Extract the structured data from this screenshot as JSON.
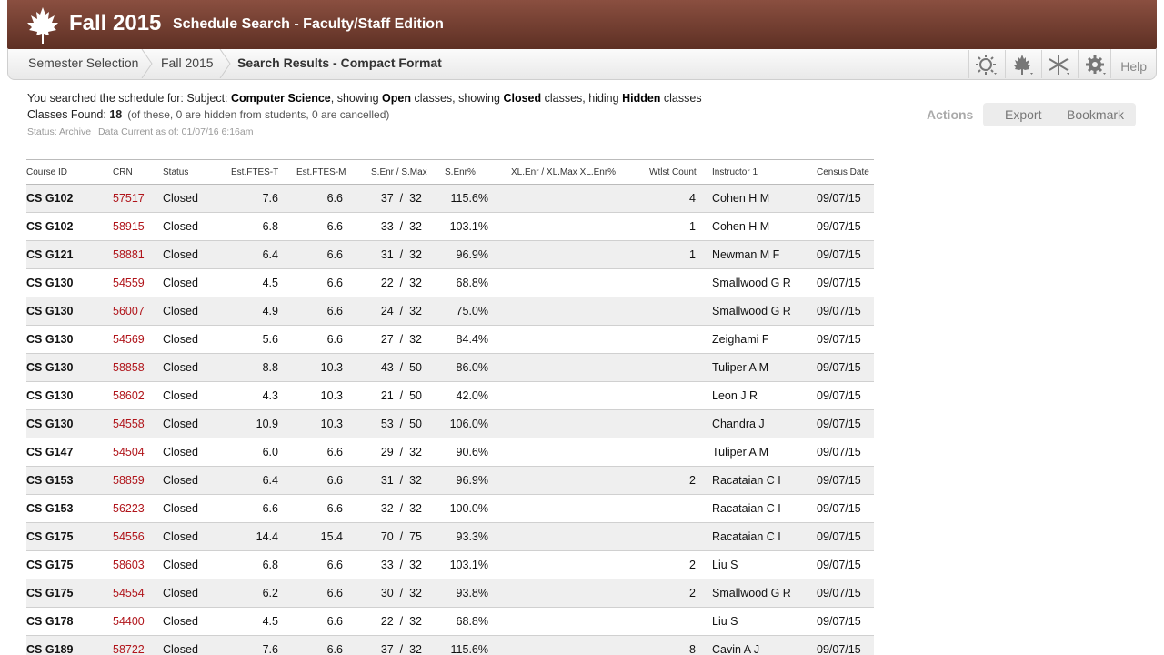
{
  "header": {
    "term": "Fall 2015",
    "title": "Schedule Search - Faculty/Staff Edition",
    "logo_icon": "maple-leaf-icon"
  },
  "breadcrumb": {
    "items": [
      "Semester Selection",
      "Fall 2015",
      "Search Results - Compact Format"
    ]
  },
  "toolbar": {
    "icons": [
      "sun-icon",
      "maple-leaf-icon",
      "asterisk-icon",
      "gear-icon"
    ],
    "help_label": "Help"
  },
  "search": {
    "prefix": "You searched the schedule for: Subject: ",
    "subject": "Computer Science",
    "mid1": ", showing ",
    "open": "Open",
    "mid2": " classes, showing ",
    "closed": "Closed",
    "mid3": " classes, hiding ",
    "hidden": "Hidden",
    "suffix": " classes",
    "found_label": "Classes Found: ",
    "found_count": "18",
    "found_note": "(of these, 0 are hidden from students, 0 are cancelled)",
    "status_label": "Status: Archive",
    "current_label": "Data Current as of: 01/07/16  6:16am"
  },
  "actions": {
    "label": "Actions",
    "export": "Export",
    "bookmark": "Bookmark"
  },
  "table": {
    "headers": {
      "course": "Course ID",
      "crn": "CRN",
      "status": "Status",
      "ftes_t": "Est.FTES-T",
      "ftes_m": "Est.FTES-M",
      "senr_max": "S.Enr  /  S.Max",
      "senr_pct": "S.Enr%",
      "xl": "XL.Enr  /  XL.Max XL.Enr%",
      "wtlst": "Wtlst Count",
      "instructor": "Instructor 1",
      "census": "Census Date"
    },
    "rows": [
      {
        "course": "CS G102",
        "crn": "57517",
        "status": "Closed",
        "ftes_t": "7.6",
        "ftes_m": "6.6",
        "senr": "37  /  32",
        "pct": "115.6%",
        "wtlst": "4",
        "instructor": "Cohen H M",
        "census": "09/07/15"
      },
      {
        "course": "CS G102",
        "crn": "58915",
        "status": "Closed",
        "ftes_t": "6.8",
        "ftes_m": "6.6",
        "senr": "33  /  32",
        "pct": "103.1%",
        "wtlst": "1",
        "instructor": "Cohen H M",
        "census": "09/07/15"
      },
      {
        "course": "CS G121",
        "crn": "58881",
        "status": "Closed",
        "ftes_t": "6.4",
        "ftes_m": "6.6",
        "senr": "31  /  32",
        "pct": "96.9%",
        "wtlst": "1",
        "instructor": "Newman M F",
        "census": "09/07/15"
      },
      {
        "course": "CS G130",
        "crn": "54559",
        "status": "Closed",
        "ftes_t": "4.5",
        "ftes_m": "6.6",
        "senr": "22  /  32",
        "pct": "68.8%",
        "wtlst": "",
        "instructor": "Smallwood G R",
        "census": "09/07/15"
      },
      {
        "course": "CS G130",
        "crn": "56007",
        "status": "Closed",
        "ftes_t": "4.9",
        "ftes_m": "6.6",
        "senr": "24  /  32",
        "pct": "75.0%",
        "wtlst": "",
        "instructor": "Smallwood G R",
        "census": "09/07/15"
      },
      {
        "course": "CS G130",
        "crn": "54569",
        "status": "Closed",
        "ftes_t": "5.6",
        "ftes_m": "6.6",
        "senr": "27  /  32",
        "pct": "84.4%",
        "wtlst": "",
        "instructor": "Zeighami F",
        "census": "09/07/15"
      },
      {
        "course": "CS G130",
        "crn": "58858",
        "status": "Closed",
        "ftes_t": "8.8",
        "ftes_m": "10.3",
        "senr": "43  /  50",
        "pct": "86.0%",
        "wtlst": "",
        "instructor": "Tuliper A M",
        "census": "09/07/15"
      },
      {
        "course": "CS G130",
        "crn": "58602",
        "status": "Closed",
        "ftes_t": "4.3",
        "ftes_m": "10.3",
        "senr": "21  /  50",
        "pct": "42.0%",
        "wtlst": "",
        "instructor": "Leon J R",
        "census": "09/07/15"
      },
      {
        "course": "CS G130",
        "crn": "54558",
        "status": "Closed",
        "ftes_t": "10.9",
        "ftes_m": "10.3",
        "senr": "53  /  50",
        "pct": "106.0%",
        "wtlst": "",
        "instructor": "Chandra J",
        "census": "09/07/15"
      },
      {
        "course": "CS G147",
        "crn": "54504",
        "status": "Closed",
        "ftes_t": "6.0",
        "ftes_m": "6.6",
        "senr": "29  /  32",
        "pct": "90.6%",
        "wtlst": "",
        "instructor": "Tuliper A M",
        "census": "09/07/15"
      },
      {
        "course": "CS G153",
        "crn": "58859",
        "status": "Closed",
        "ftes_t": "6.4",
        "ftes_m": "6.6",
        "senr": "31  /  32",
        "pct": "96.9%",
        "wtlst": "2",
        "instructor": "Racataian C I",
        "census": "09/07/15"
      },
      {
        "course": "CS G153",
        "crn": "56223",
        "status": "Closed",
        "ftes_t": "6.6",
        "ftes_m": "6.6",
        "senr": "32  /  32",
        "pct": "100.0%",
        "wtlst": "",
        "instructor": "Racataian C I",
        "census": "09/07/15"
      },
      {
        "course": "CS G175",
        "crn": "54556",
        "status": "Closed",
        "ftes_t": "14.4",
        "ftes_m": "15.4",
        "senr": "70  /  75",
        "pct": "93.3%",
        "wtlst": "",
        "instructor": "Racataian C I",
        "census": "09/07/15"
      },
      {
        "course": "CS G175",
        "crn": "58603",
        "status": "Closed",
        "ftes_t": "6.8",
        "ftes_m": "6.6",
        "senr": "33  /  32",
        "pct": "103.1%",
        "wtlst": "2",
        "instructor": "Liu S",
        "census": "09/07/15"
      },
      {
        "course": "CS G175",
        "crn": "54554",
        "status": "Closed",
        "ftes_t": "6.2",
        "ftes_m": "6.6",
        "senr": "30  /  32",
        "pct": "93.8%",
        "wtlst": "2",
        "instructor": "Smallwood G R",
        "census": "09/07/15"
      },
      {
        "course": "CS G178",
        "crn": "54400",
        "status": "Closed",
        "ftes_t": "4.5",
        "ftes_m": "6.6",
        "senr": "22  /  32",
        "pct": "68.8%",
        "wtlst": "",
        "instructor": "Liu S",
        "census": "09/07/15"
      },
      {
        "course": "CS G189",
        "crn": "58722",
        "status": "Closed",
        "ftes_t": "7.6",
        "ftes_m": "6.6",
        "senr": "37  /  32",
        "pct": "115.6%",
        "wtlst": "8",
        "instructor": "Cavin A J",
        "census": "09/07/15"
      }
    ]
  },
  "colors": {
    "header_top": "#8a4f40",
    "header_bottom": "#5e3024",
    "crn_link": "#b0141a",
    "row_alt": "#efefef"
  }
}
